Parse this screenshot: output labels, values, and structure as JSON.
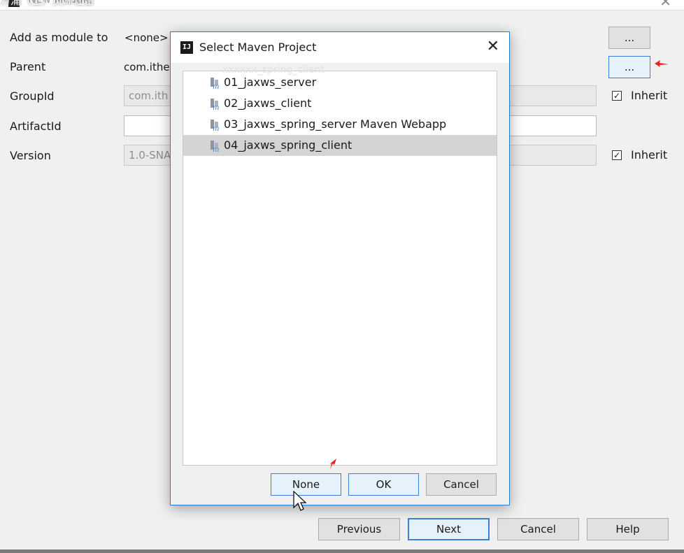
{
  "wizard": {
    "title": "New Module",
    "overlay_text": "万浦（土）贞沐仕留",
    "fields": {
      "add_as_module_to": {
        "label": "Add as module to",
        "value": "<none>"
      },
      "parent": {
        "label": "Parent",
        "value": "com.ithe"
      },
      "group_id": {
        "label": "GroupId",
        "value": "com.ith"
      },
      "artifact_id": {
        "label": "ArtifactId",
        "value": ""
      },
      "version": {
        "label": "Version",
        "value": "1.0-SNA"
      }
    },
    "browse_label": "...",
    "inherit_label": "Inherit",
    "buttons": {
      "previous": "Previous",
      "next": "Next",
      "cancel": "Cancel",
      "help": "Help"
    }
  },
  "dialog": {
    "title": "Select Maven Project",
    "ghost_text": "xxxxxx_spring_client",
    "projects": [
      {
        "label": "01_jaxws_server",
        "selected": false
      },
      {
        "label": "02_jaxws_client",
        "selected": false
      },
      {
        "label": "03_jaxws_spring_server Maven Webapp",
        "selected": false
      },
      {
        "label": "04_jaxws_spring_client",
        "selected": true
      }
    ],
    "buttons": {
      "none": "None",
      "ok": "OK",
      "cancel": "Cancel"
    }
  },
  "colors": {
    "accent": "#3c7fd4",
    "dialog_border": "#1e7fd6",
    "selection": "#d4d4d4",
    "annotation_red": "#e8231c"
  },
  "icons": {
    "app": "intellij-icon",
    "project": "maven-module-icon",
    "close": "close-icon",
    "annotation": "red-arrow-icon",
    "pointer": "mouse-cursor-icon"
  }
}
